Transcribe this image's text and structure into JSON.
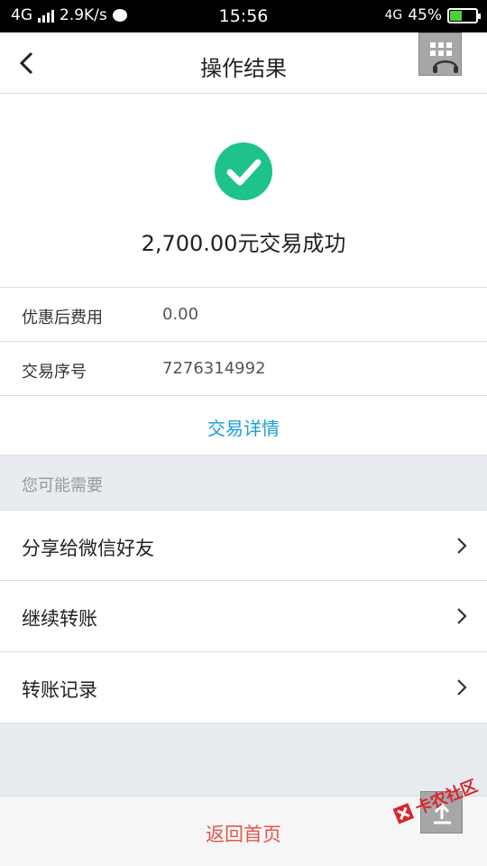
{
  "status_bar": {
    "network": "4G",
    "speed": "2.9K/s",
    "time": "15:56",
    "network_right": "4G",
    "battery": "45%",
    "battery_level": 0.45
  },
  "nav": {
    "title": "操作结果",
    "back_icon": "chevron-left-icon",
    "fab_icon": "floating-menu-icon"
  },
  "result": {
    "icon": "check-circle-icon",
    "amount_text": "2,700.00元交易成功",
    "accent_color": "#1ec28b"
  },
  "info": {
    "rows": [
      {
        "label": "优惠后费用",
        "value": "0.00"
      },
      {
        "label": "交易序号",
        "value": "7276314992"
      }
    ]
  },
  "detail_link": "交易详情",
  "section_header": "您可能需要",
  "actions": {
    "items": [
      {
        "label": "分享给微信好友"
      },
      {
        "label": "继续转账"
      },
      {
        "label": "转账记录"
      }
    ]
  },
  "bottom": {
    "home_label": "返回首页",
    "home_color": "#e2574c"
  },
  "watermark": {
    "text": "卡农社区"
  },
  "colors": {
    "link": "#1aa0d8",
    "success": "#1ec28b",
    "background": "#e8ebef"
  }
}
